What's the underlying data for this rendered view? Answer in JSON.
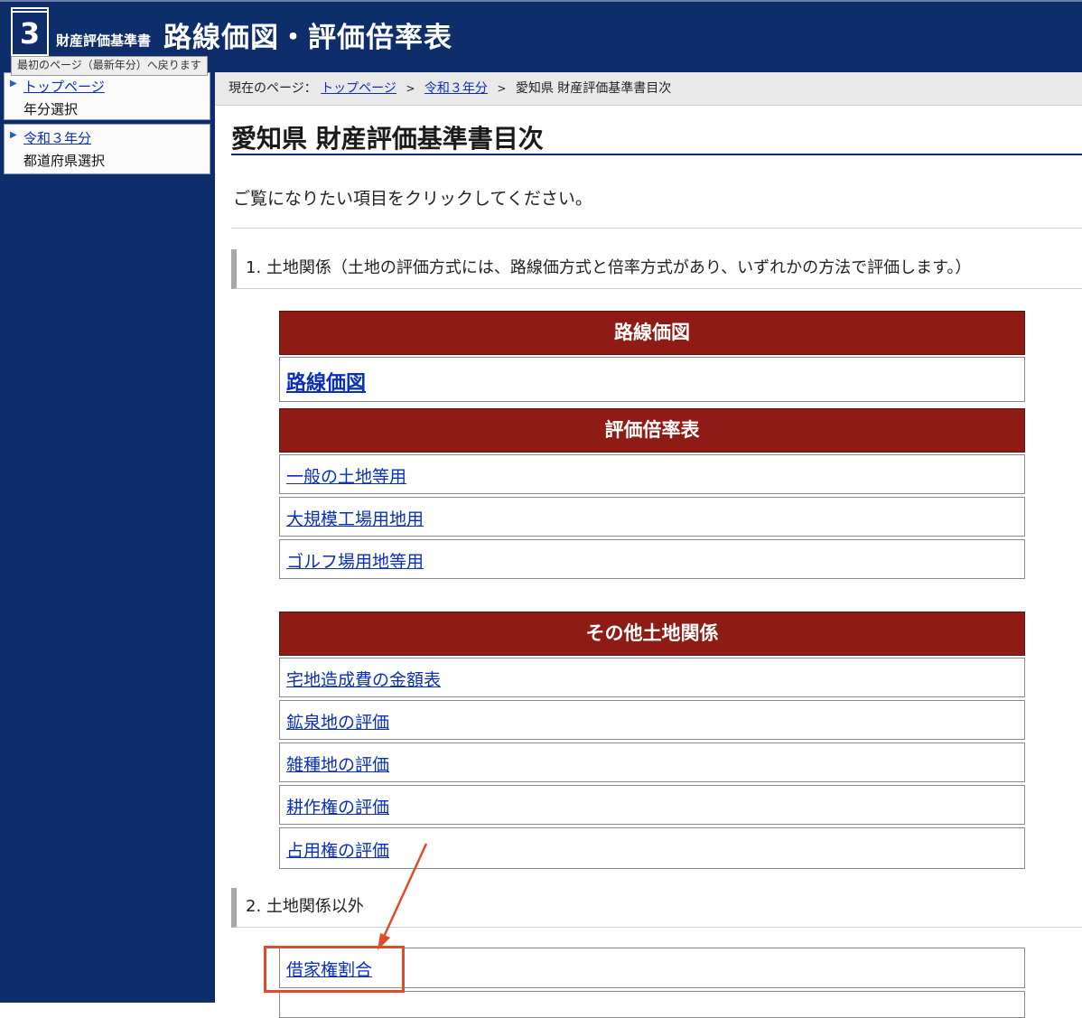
{
  "header": {
    "logo_number": "3",
    "logo_small": "財産評価基準書",
    "logo_big": "路線価図・評価倍率表",
    "tooltip": "最初のページ（最新年分）へ戻ります"
  },
  "sidebar": {
    "items": [
      {
        "link": "トップページ",
        "sub": "年分選択"
      },
      {
        "link": "令和３年分",
        "sub": "都道府県選択"
      }
    ]
  },
  "breadcrumb": {
    "prefix": "現在のページ：",
    "links": [
      "トップページ",
      "令和３年分"
    ],
    "separator": ">",
    "current": "愛知県 財産評価基準書目次"
  },
  "page": {
    "title": "愛知県 財産評価基準書目次",
    "intro": "ご覧になりたい項目をクリックしてください。"
  },
  "sections": {
    "s1": "1. 土地関係（土地の評価方式には、路線価方式と倍率方式があり、いずれかの方法で評価します。）",
    "s2": "2. 土地関係以外"
  },
  "categories": {
    "rosenka": {
      "title": "路線価図",
      "items": [
        "路線価図"
      ]
    },
    "bairitsu": {
      "title": "評価倍率表",
      "items": [
        "一般の土地等用",
        "大規模工場用地用",
        "ゴルフ場用地等用"
      ]
    },
    "other": {
      "title": "その他土地関係",
      "items": [
        "宅地造成費の金額表",
        "鉱泉地の評価",
        "雑種地の評価",
        "耕作権の評価",
        "占用権の評価"
      ]
    },
    "non_land": {
      "items": [
        "借家権割合"
      ]
    }
  },
  "colors": {
    "navy": "#0e2d6b",
    "category_red": "#8f1c14",
    "link_blue": "#0b2fb8",
    "annotation_red": "#e04b2a"
  }
}
